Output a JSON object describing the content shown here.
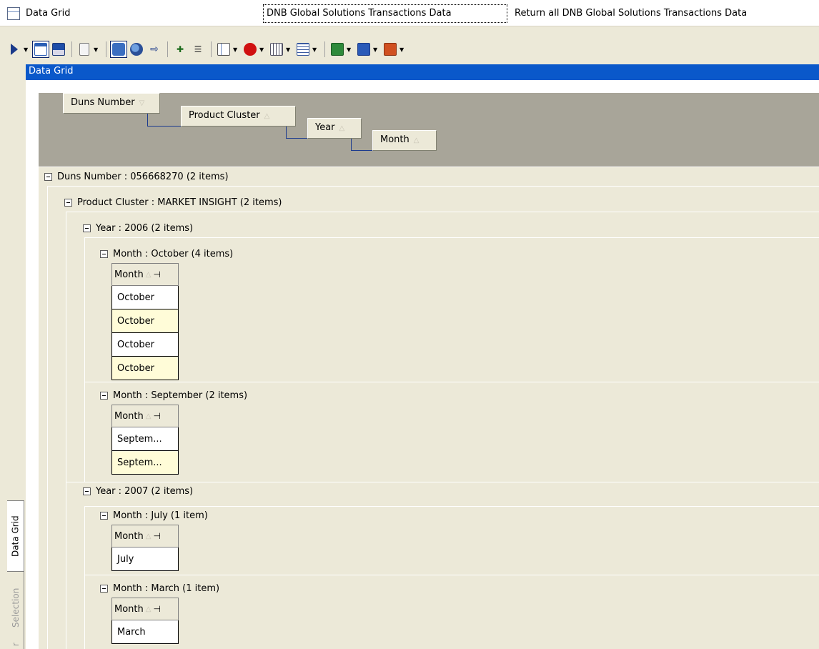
{
  "titlebar": {
    "app_name": "Data Grid",
    "tab_label": "DNB Global Solutions Transactions Data",
    "description": "Return all DNB Global Solutions Transactions Data"
  },
  "toolbar": {
    "icons": [
      "play-icon",
      "new-window-icon",
      "save-icon",
      "clipboard-icon",
      "lock-icon",
      "binoculars-icon",
      "export-arrow-icon",
      "add-column-icon",
      "remove-column-icon",
      "grid-options-icon",
      "stop-icon",
      "columns-icon",
      "table-icon",
      "excel-icon",
      "word-icon",
      "report-icon"
    ]
  },
  "panel": {
    "title": "Data Grid"
  },
  "side_tabs": {
    "active": "Data Grid",
    "inactive": "Selection",
    "cut": "r"
  },
  "group_by": [
    "Duns Number",
    "Product Cluster",
    "Year",
    "Month"
  ],
  "tree": {
    "duns": "Duns Number : 056668270 (2 items)",
    "cluster": "Product Cluster : MARKET INSIGHT (2 items)",
    "year1": "Year : 2006 (2 items)",
    "month_oct": "Month : October (4 items)",
    "oct_rows": [
      "October",
      "October",
      "October",
      "October"
    ],
    "month_sep": "Month : September (2 items)",
    "sep_rows": [
      "Septem...",
      "Septem..."
    ],
    "year2": "Year : 2007 (2 items)",
    "month_jul": "Month : July (1 item)",
    "jul_rows": [
      "July"
    ],
    "month_mar": "Month : March (1 item)",
    "mar_rows": [
      "March"
    ],
    "column_header": "Month"
  },
  "colors": {
    "panel_header": "#0a58ca",
    "group_area": "#a8a599",
    "tree_bg": "#ece9d8",
    "alt_row": "#fffcd8"
  }
}
